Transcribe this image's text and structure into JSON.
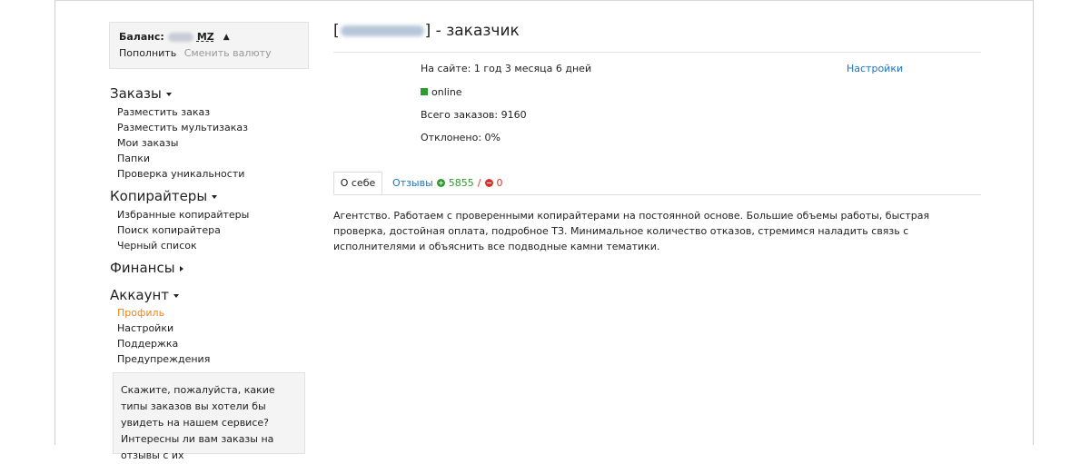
{
  "balance": {
    "label": "Баланс:",
    "currency": "MZ",
    "topup": "Пополнить",
    "change_currency": "Сменить валюту"
  },
  "sidebar": {
    "orders": {
      "title": "Заказы",
      "items": [
        "Разместить заказ",
        "Разместить мультизаказ",
        "Мои заказы",
        "Папки",
        "Проверка уникальности"
      ]
    },
    "copywriters": {
      "title": "Копирайтеры",
      "items": [
        "Избранные копирайтеры",
        "Поиск копирайтера",
        "Черный список"
      ]
    },
    "finance": {
      "title": "Финансы"
    },
    "account": {
      "title": "Аккаунт",
      "items": [
        "Профиль",
        "Настройки",
        "Поддержка",
        "Предупреждения"
      ],
      "active_index": 0
    },
    "notice": "Скажите, пожалуйста, какие типы заказов вы хотели бы увидеть на нашем сервисе? Интересны ли вам заказы на отзывы с их"
  },
  "profile": {
    "title_open": "[",
    "title_close": "] - заказчик",
    "on_site": "На сайте: 1 год 3 месяца 6 дней",
    "status": "online",
    "total_orders": "Всего заказов: 9160",
    "rejected": "Отклонено: 0%",
    "settings_link": "Настройки"
  },
  "tabs": {
    "about": "О себе",
    "reviews": "Отзывы",
    "positive": "5855",
    "separator": "/",
    "negative": "0"
  },
  "about_text": "Агентство. Работаем с проверенными копирайтерами на постоянной основе. Большие объемы работы, быстрая проверка, достойная оплата, подробное ТЗ. Минимальное количество отказов, стремимся наладить связь с исполнителями и объяснить все подводные камни тематики.",
  "colors": {
    "accent_orange": "#f0861a",
    "link_blue": "#1a73c8",
    "positive_green": "#2e9b2e",
    "negative_red": "#d9342b"
  }
}
